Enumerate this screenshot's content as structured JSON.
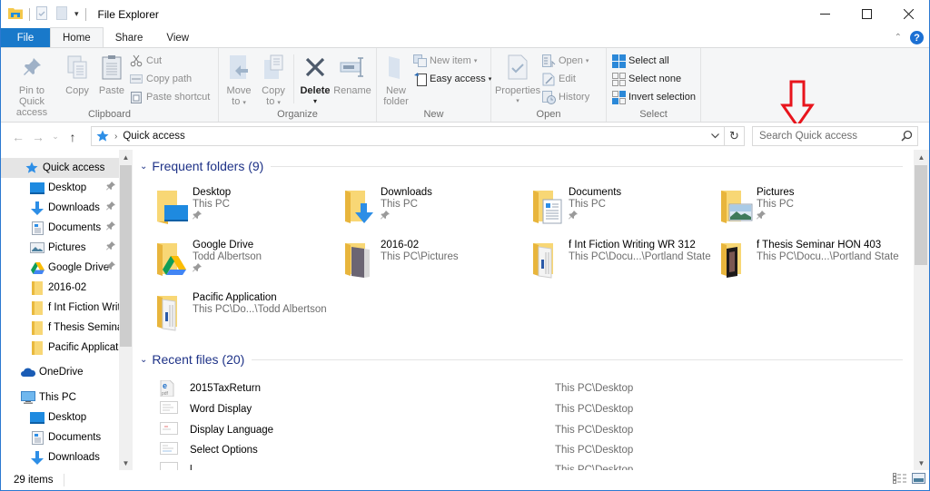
{
  "window": {
    "title": "File Explorer",
    "controls": {
      "minimize": "—",
      "maximize": "☐",
      "close": "✕"
    }
  },
  "tabs": [
    {
      "label": "File"
    },
    {
      "label": "Home"
    },
    {
      "label": "Share"
    },
    {
      "label": "View"
    }
  ],
  "ribbon": {
    "clipboard": {
      "label": "Clipboard",
      "pin": "Pin to Quick access",
      "pin_line1": "Pin to Quick",
      "pin_line2": "access",
      "copy": "Copy",
      "paste": "Paste",
      "cut": "Cut",
      "copy_path": "Copy path",
      "paste_shortcut": "Paste shortcut"
    },
    "organize": {
      "label": "Organize",
      "move_to_1": "Move",
      "move_to_2": "to",
      "copy_to_1": "Copy",
      "copy_to_2": "to",
      "delete": "Delete",
      "rename": "Rename"
    },
    "new": {
      "label": "New",
      "new_folder_1": "New",
      "new_folder_2": "folder",
      "new_item": "New item",
      "easy_access": "Easy access"
    },
    "open": {
      "label": "Open",
      "properties": "Properties",
      "open": "Open",
      "edit": "Edit",
      "history": "History"
    },
    "select": {
      "label": "Select",
      "select_all": "Select all",
      "select_none": "Select none",
      "invert_selection": "Invert selection"
    }
  },
  "address": {
    "location": "Quick access",
    "search_placeholder": "Search Quick access"
  },
  "sidebar": {
    "items": [
      {
        "label": "Quick access",
        "selected": true
      },
      {
        "label": "Desktop",
        "pinned": true
      },
      {
        "label": "Downloads",
        "pinned": true
      },
      {
        "label": "Documents",
        "pinned": true
      },
      {
        "label": "Pictures",
        "pinned": true
      },
      {
        "label": "Google Drive",
        "pinned": true
      },
      {
        "label": "2016-02"
      },
      {
        "label": "f Int Fiction Writ"
      },
      {
        "label": "f Thesis Seminar"
      },
      {
        "label": "Pacific Applicati"
      },
      {
        "label": "OneDrive"
      },
      {
        "label": "This PC"
      },
      {
        "label": "Desktop"
      },
      {
        "label": "Documents"
      },
      {
        "label": "Downloads"
      }
    ]
  },
  "frequent": {
    "title": "Frequent folders (9)",
    "folders": [
      {
        "name": "Desktop",
        "location": "This PC",
        "pinned": true
      },
      {
        "name": "Downloads",
        "location": "This PC",
        "pinned": true
      },
      {
        "name": "Documents",
        "location": "This PC",
        "pinned": true
      },
      {
        "name": "Pictures",
        "location": "This PC",
        "pinned": true
      },
      {
        "name": "Google Drive",
        "location": "Todd Albertson",
        "pinned": true
      },
      {
        "name": "2016-02",
        "location": "This PC\\Pictures"
      },
      {
        "name": "f Int Fiction Writing WR 312",
        "location": "This PC\\Docu...\\Portland State"
      },
      {
        "name": "f Thesis Seminar HON 403",
        "location": "This PC\\Docu...\\Portland State"
      },
      {
        "name": "Pacific Application",
        "location": "This PC\\Do...\\Todd Albertson"
      }
    ]
  },
  "recent": {
    "title": "Recent files (20)",
    "files": [
      {
        "name": "2015TaxReturn",
        "path": "This PC\\Desktop"
      },
      {
        "name": "Word Display",
        "path": "This PC\\Desktop"
      },
      {
        "name": "Display Language",
        "path": "This PC\\Desktop"
      },
      {
        "name": "Select Options",
        "path": "This PC\\Desktop"
      },
      {
        "name": "l",
        "path": "This PC\\Desktop"
      }
    ]
  },
  "status": {
    "item_count": "29 items"
  },
  "colors": {
    "accent": "#1979ca",
    "section_header": "#1e3287",
    "annotation": "#e8141c"
  }
}
